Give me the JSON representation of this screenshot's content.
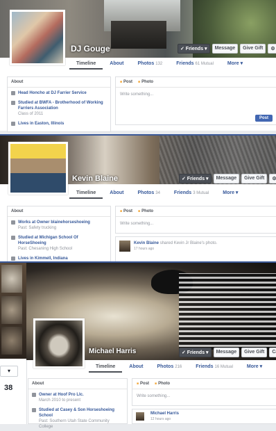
{
  "profiles": [
    {
      "name": "DJ Gouge",
      "actions": {
        "friends": "✓ Friends ▾",
        "message": "Message",
        "gift": "Give Gift",
        "more": "⚙ ▾"
      },
      "tabs": {
        "timeline": "Timeline",
        "about": "About",
        "photos": "Photos",
        "photos_count": "132",
        "friends": "Friends",
        "friends_count": "61 Mutual",
        "more": "More ▾"
      },
      "about": {
        "header": "About",
        "items": [
          {
            "text": "Head Honcho at DJ Farrier Service",
            "sub": ""
          },
          {
            "text": "Studied at BWFA - Brotherhood of Working Farriers Association",
            "sub": "Class of 2011"
          },
          {
            "text": "Lives in Easton, Illinois",
            "sub": ""
          }
        ]
      },
      "composer": {
        "post_tab": "Post",
        "photo_tab": "Photo",
        "placeholder": "Write something...",
        "post_button": "Post"
      }
    },
    {
      "name": "Kevin Blaine",
      "actions": {
        "friends": "✓ Friends ▾",
        "message": "Message",
        "gift": "Give Gift",
        "more": "⚙ ▾"
      },
      "tabs": {
        "timeline": "Timeline",
        "about": "About",
        "photos": "Photos",
        "photos_count": "34",
        "friends": "Friends",
        "friends_count": "3 Mutual",
        "more": "More ▾"
      },
      "about": {
        "header": "About",
        "items": [
          {
            "text": "Works at Owner blainehorseshoeing",
            "sub": "Past: Safety trucking"
          },
          {
            "text": "Studied at Michigan School Of HorseShoeing",
            "sub": "Past: Chesaning High School"
          },
          {
            "text": "Lives in Kimmell, Indiana",
            "sub": ""
          }
        ]
      },
      "composer": {
        "post_tab": "Post",
        "photo_tab": "Photo",
        "placeholder": "Write something..."
      },
      "story": {
        "author": "Kevin Blaine",
        "action": "shared Kevin Jr Blaine's photo.",
        "time": "17 hours ago"
      }
    },
    {
      "name": "Michael Harris",
      "actions": {
        "friends": "✓ Friends ▾",
        "message": "Message",
        "gift": "Give Gift",
        "call": "Call",
        "more": "⚙ ▾"
      },
      "tabs": {
        "timeline": "Timeline",
        "about": "About",
        "photos": "Photos",
        "photos_count": "216",
        "friends": "Friends",
        "friends_count": "16 Mutual",
        "more": "More ▾"
      },
      "about": {
        "header": "About",
        "items": [
          {
            "text": "Owner at Hoof Pro Llc.",
            "sub": "March 2010 to present"
          },
          {
            "text": "Studied at Casey & Son Horseshoeing School",
            "sub": "Past: Southern Utah State Community College"
          }
        ]
      },
      "composer": {
        "post_tab": "Post",
        "photo_tab": "Photo",
        "placeholder": "Write something..."
      },
      "story": {
        "author": "Michael Harris",
        "time": "12 hours ago"
      }
    }
  ],
  "left_panel": {
    "count": "38"
  }
}
